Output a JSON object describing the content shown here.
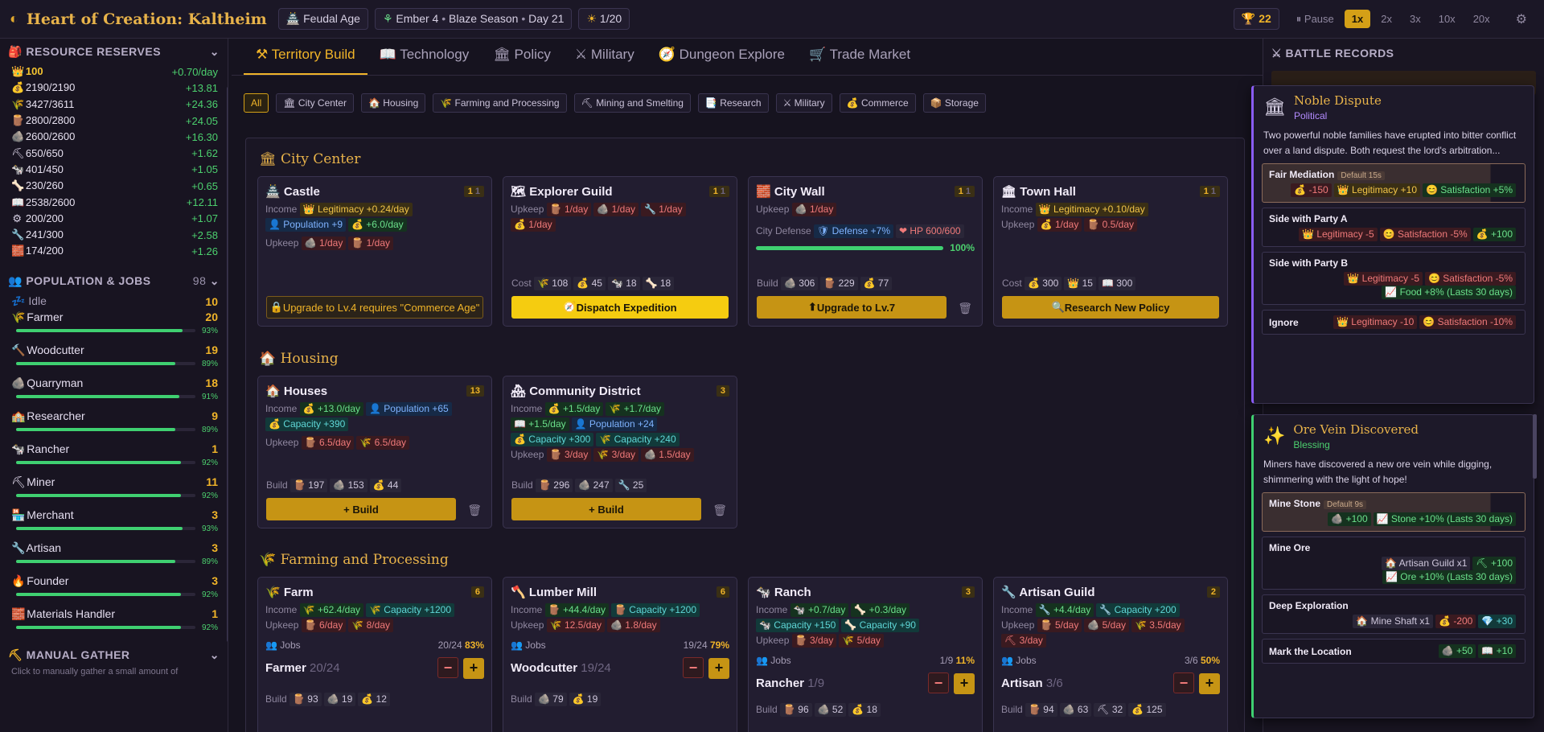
{
  "header": {
    "title": "Heart of Creation: Kaltheim",
    "age": "Feudal Age",
    "season": "Ember 4",
    "season2": "Blaze Season",
    "day": "Day 21",
    "turns": "1/20",
    "trophy": "22",
    "pause": "Pause",
    "speeds": [
      "1x",
      "2x",
      "3x",
      "10x",
      "20x"
    ]
  },
  "colors": {
    "accent": "#f0b429",
    "positive": "#3fd071",
    "negative": "#f07a7a"
  },
  "resources": {
    "title": "RESOURCE RESERVES",
    "items": [
      {
        "icon": "👑",
        "v": "100",
        "r": "+0.70/day"
      },
      {
        "icon": "💰",
        "v": "2190/2190",
        "r": "+13.81"
      },
      {
        "icon": "🌾",
        "v": "3427/3611",
        "r": "+24.36"
      },
      {
        "icon": "🪵",
        "v": "2800/2800",
        "r": "+24.05"
      },
      {
        "icon": "🪨",
        "v": "2600/2600",
        "r": "+16.30"
      },
      {
        "icon": "⛏",
        "v": "650/650",
        "r": "+1.62"
      },
      {
        "icon": "🐄",
        "v": "401/450",
        "r": "+1.05"
      },
      {
        "icon": "🦴",
        "v": "230/260",
        "r": "+0.65"
      },
      {
        "icon": "📖",
        "v": "2538/2600",
        "r": "+12.11"
      },
      {
        "icon": "⚙",
        "v": "200/200",
        "r": "+1.07"
      },
      {
        "icon": "🔧",
        "v": "241/300",
        "r": "+2.58"
      },
      {
        "icon": "🧱",
        "v": "174/200",
        "r": "+1.26"
      }
    ]
  },
  "population": {
    "title": "POPULATION & JOBS",
    "count": "98",
    "idle_label": "Idle",
    "idle": "10",
    "jobs": [
      {
        "icon": "🌾",
        "name": "Farmer",
        "n": "20",
        "pct": "93%",
        "p": 0.93
      },
      {
        "icon": "🔨",
        "name": "Woodcutter",
        "n": "19",
        "pct": "89%",
        "p": 0.89
      },
      {
        "icon": "🪨",
        "name": "Quarryman",
        "n": "18",
        "pct": "91%",
        "p": 0.91
      },
      {
        "icon": "🏫",
        "name": "Researcher",
        "n": "9",
        "pct": "89%",
        "p": 0.89
      },
      {
        "icon": "🐄",
        "name": "Rancher",
        "n": "1",
        "pct": "92%",
        "p": 0.92
      },
      {
        "icon": "⛏",
        "name": "Miner",
        "n": "11",
        "pct": "92%",
        "p": 0.92
      },
      {
        "icon": "🏪",
        "name": "Merchant",
        "n": "3",
        "pct": "93%",
        "p": 0.93
      },
      {
        "icon": "🔧",
        "name": "Artisan",
        "n": "3",
        "pct": "89%",
        "p": 0.89
      },
      {
        "icon": "🔥",
        "name": "Founder",
        "n": "3",
        "pct": "92%",
        "p": 0.92
      },
      {
        "icon": "🧱",
        "name": "Materials Handler",
        "n": "1",
        "pct": "92%",
        "p": 0.92
      }
    ]
  },
  "gather": {
    "title": "MANUAL GATHER",
    "desc": "Click to manually gather a small amount of"
  },
  "tabs": [
    "Territory Build",
    "Technology",
    "Policy",
    "Military",
    "Dungeon Explore",
    "Trade Market"
  ],
  "filters": [
    "All",
    "City Center",
    "Housing",
    "Farming and Processing",
    "Mining and Smelting",
    "Research",
    "Military",
    "Commerce",
    "Storage"
  ],
  "sections": {
    "city": "City Center",
    "housing": "Housing",
    "farming": "Farming and Processing"
  },
  "labels": {
    "income": "Income",
    "upkeep": "Upkeep",
    "build": "Build",
    "cost": "Cost",
    "jobs": "Jobs",
    "defense": "City Defense",
    "plus_build": "+ Build"
  },
  "cards": {
    "castle": {
      "name": "Castle",
      "lv": "1",
      "max": "1",
      "btn": "Upgrade to Lv.4 requires \"Commerce Age\""
    },
    "explorer": {
      "name": "Explorer Guild",
      "lv": "1",
      "max": "1",
      "btn": "Dispatch Expedition"
    },
    "wall": {
      "name": "City Wall",
      "lv": "1",
      "max": "1",
      "pct": "100%",
      "p": 1.0,
      "btn": "Upgrade to Lv.7"
    },
    "townhall": {
      "name": "Town Hall",
      "lv": "1",
      "max": "1",
      "btn": "Research New Policy"
    },
    "houses": {
      "name": "Houses",
      "n": "13"
    },
    "community": {
      "name": "Community District",
      "n": "3"
    },
    "farm": {
      "name": "Farm",
      "n": "6",
      "jobs": "20/24",
      "pct": "83%",
      "job": "Farmer",
      "jobc": "20/24"
    },
    "mill": {
      "name": "Lumber Mill",
      "n": "6",
      "jobs": "19/24",
      "pct": "79%",
      "job": "Woodcutter",
      "jobc": "19/24"
    },
    "ranch": {
      "name": "Ranch",
      "n": "3",
      "jobs": "1/9",
      "pct": "11%",
      "job": "Rancher",
      "jobc": "1/9"
    },
    "artisan": {
      "name": "Artisan Guild",
      "n": "2",
      "jobs": "3/6",
      "pct": "50%",
      "job": "Artisan",
      "jobc": "3/6"
    }
  },
  "battle": {
    "title": "BATTLE RECORDS"
  },
  "events": [
    {
      "title": "Noble Dispute",
      "type": "Political",
      "desc": "Two powerful noble families have erupted into bitter conflict over a land dispute. Both request the lord's arbitration...",
      "opts": [
        {
          "name": "Fair Mediation",
          "def": "Default 15s",
          "eff": [
            [
              "r",
              "💰 -150"
            ],
            [
              "y",
              "👑 Legitimacy +10"
            ],
            [
              "g",
              "😊 Satisfaction +5%"
            ]
          ]
        },
        {
          "name": "Side with Party A",
          "eff": [
            [
              "r",
              "👑 Legitimacy -5"
            ],
            [
              "r",
              "😊 Satisfaction -5%"
            ],
            [
              "g",
              "💰 +100"
            ]
          ]
        },
        {
          "name": "Side with Party B",
          "eff": [
            [
              "r",
              "👑 Legitimacy -5"
            ],
            [
              "r",
              "😊 Satisfaction -5%"
            ],
            [
              "g",
              "📈 Food +8% (Lasts 30 days)"
            ]
          ]
        },
        {
          "name": "Ignore",
          "eff": [
            [
              "r",
              "👑 Legitimacy -10"
            ],
            [
              "r",
              "😊 Satisfaction -10%"
            ]
          ]
        }
      ]
    },
    {
      "title": "Ore Vein Discovered",
      "type": "Blessing",
      "desc": "Miners have discovered a new ore vein while digging, shimmering with the light of hope!",
      "opts": [
        {
          "name": "Mine Stone",
          "def": "Default 9s",
          "eff": [
            [
              "g",
              "🪨 +100"
            ],
            [
              "g",
              "📈 Stone +10% (Lasts 30 days)"
            ]
          ]
        },
        {
          "name": "Mine Ore",
          "eff": [
            [
              "k",
              "🏠 Artisan Guild x1"
            ],
            [
              "g",
              "⛏ +100"
            ],
            [
              "g",
              "📈 Ore +10% (Lasts 30 days)"
            ]
          ]
        },
        {
          "name": "Deep Exploration",
          "eff": [
            [
              "k",
              "🏠 Mine Shaft x1"
            ],
            [
              "r",
              "💰 -200"
            ],
            [
              "c",
              "💎 +30"
            ]
          ]
        },
        {
          "name": "Mark the Location",
          "eff": [
            [
              "g",
              "🪨 +50"
            ],
            [
              "g",
              "📖 +10"
            ]
          ]
        }
      ]
    }
  ]
}
